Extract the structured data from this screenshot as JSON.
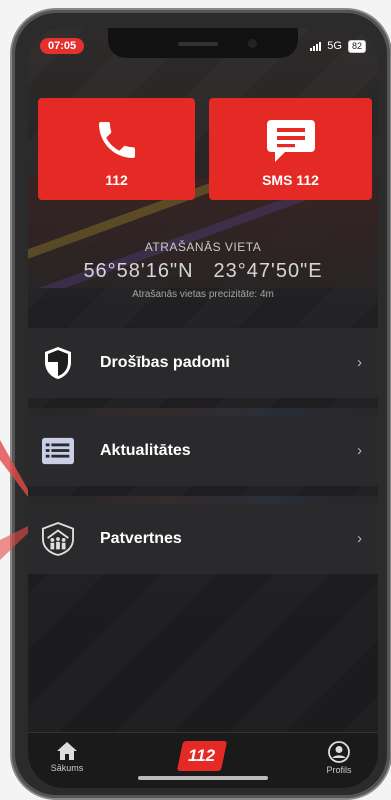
{
  "status_bar": {
    "time": "07:05",
    "network": "5G",
    "battery": "82"
  },
  "actions": {
    "call_label": "112",
    "sms_label": "SMS 112"
  },
  "location": {
    "heading": "ATRAŠANĀS VIETA",
    "latitude": "56°58'16\"N",
    "longitude": "23°47'50\"E",
    "accuracy": "Atrašanās vietas precizitāte: 4m"
  },
  "menu": {
    "items": [
      {
        "label": "Drošības padomi",
        "icon": "shield-icon"
      },
      {
        "label": "Aktualitātes",
        "icon": "news-list-icon"
      },
      {
        "label": "Patvertnes",
        "icon": "shelter-icon"
      }
    ]
  },
  "tab_bar": {
    "home_label": "Sākums",
    "center_label": "112",
    "profile_label": "Profils"
  },
  "colors": {
    "accent": "#e52a25",
    "background": "#1f1f21",
    "menu_item": "#2a2a2c"
  }
}
